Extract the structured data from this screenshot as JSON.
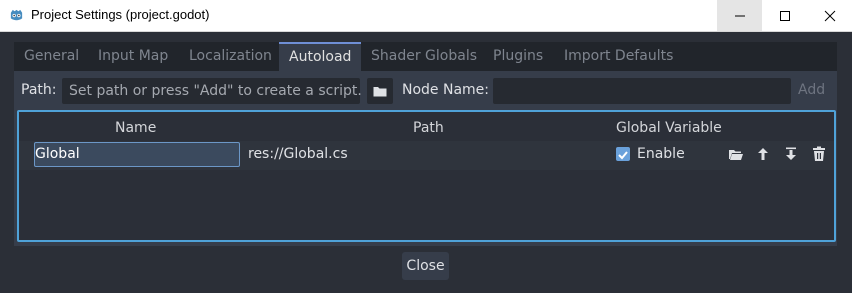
{
  "window": {
    "title": "Project Settings (project.godot)",
    "icons": [
      "godot-logo-icon",
      "minimize-icon",
      "maximize-icon",
      "close-icon"
    ]
  },
  "tabs": [
    {
      "label": "General"
    },
    {
      "label": "Input Map"
    },
    {
      "label": "Localization"
    },
    {
      "label": "Autoload",
      "active": true
    },
    {
      "label": "Shader Globals"
    },
    {
      "label": "Plugins"
    },
    {
      "label": "Import Defaults"
    }
  ],
  "autoload": {
    "path_label": "Path:",
    "path_placeholder": "Set path or press \"Add\" to create a script.",
    "node_name_label": "Node Name:",
    "node_name_value": "",
    "add_label": "Add",
    "columns": [
      "Name",
      "Path",
      "Global Variable"
    ],
    "rows": [
      {
        "name": "Global",
        "path": "res://Global.cs",
        "enable_label": "Enable",
        "enabled": true
      }
    ]
  },
  "footer": {
    "close_label": "Close"
  },
  "colors": {
    "accent": "#6f8fd6",
    "selection_border": "#4fa2d8",
    "checkbox": "#6aa1db"
  }
}
